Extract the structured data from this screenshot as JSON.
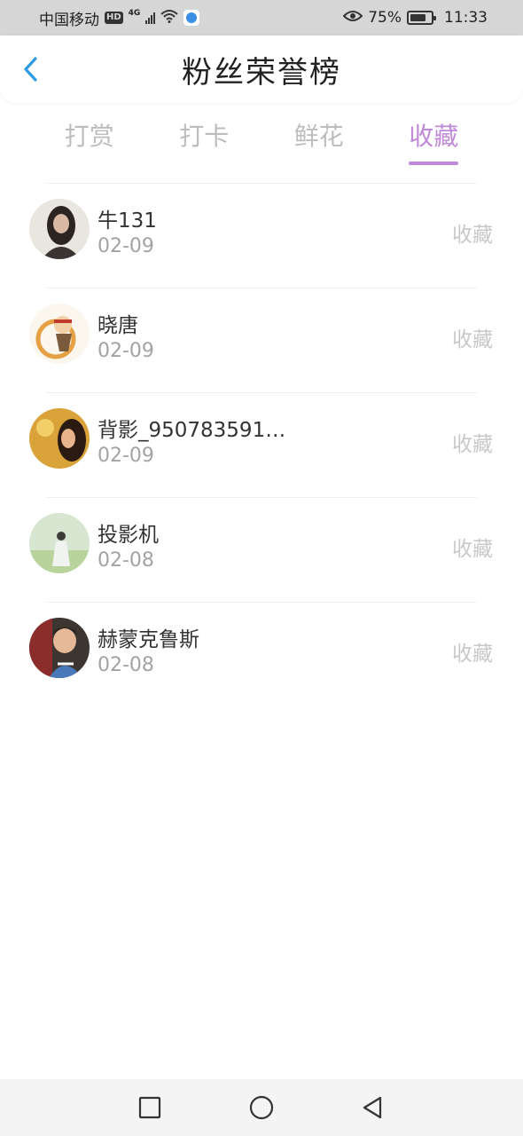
{
  "status_bar": {
    "carrier": "中国移动",
    "hd_badge": "HD",
    "network": "4G",
    "battery": "75%",
    "battery_level": 0.75,
    "time": "11:33"
  },
  "header": {
    "title": "粉丝荣誉榜",
    "back_icon": "chevron-left-icon",
    "accent_color": "#2f9be6"
  },
  "tabs": [
    {
      "label": "打赏",
      "active": false
    },
    {
      "label": "打卡",
      "active": false
    },
    {
      "label": "鲜花",
      "active": false
    },
    {
      "label": "收藏",
      "active": true
    }
  ],
  "active_tab_color": "#c08ad9",
  "fans": [
    {
      "name": "牛131",
      "date": "02-09",
      "action": "收藏"
    },
    {
      "name": "晓唐",
      "date": "02-09",
      "action": "收藏"
    },
    {
      "name": "背影_950783591…",
      "date": "02-09",
      "action": "收藏"
    },
    {
      "name": "投影机",
      "date": "02-08",
      "action": "收藏"
    },
    {
      "name": "赫蒙克鲁斯",
      "date": "02-08",
      "action": "收藏"
    }
  ],
  "nav_bar": {
    "recent_icon": "square-icon",
    "home_icon": "circle-icon",
    "back_icon": "triangle-back-icon"
  }
}
